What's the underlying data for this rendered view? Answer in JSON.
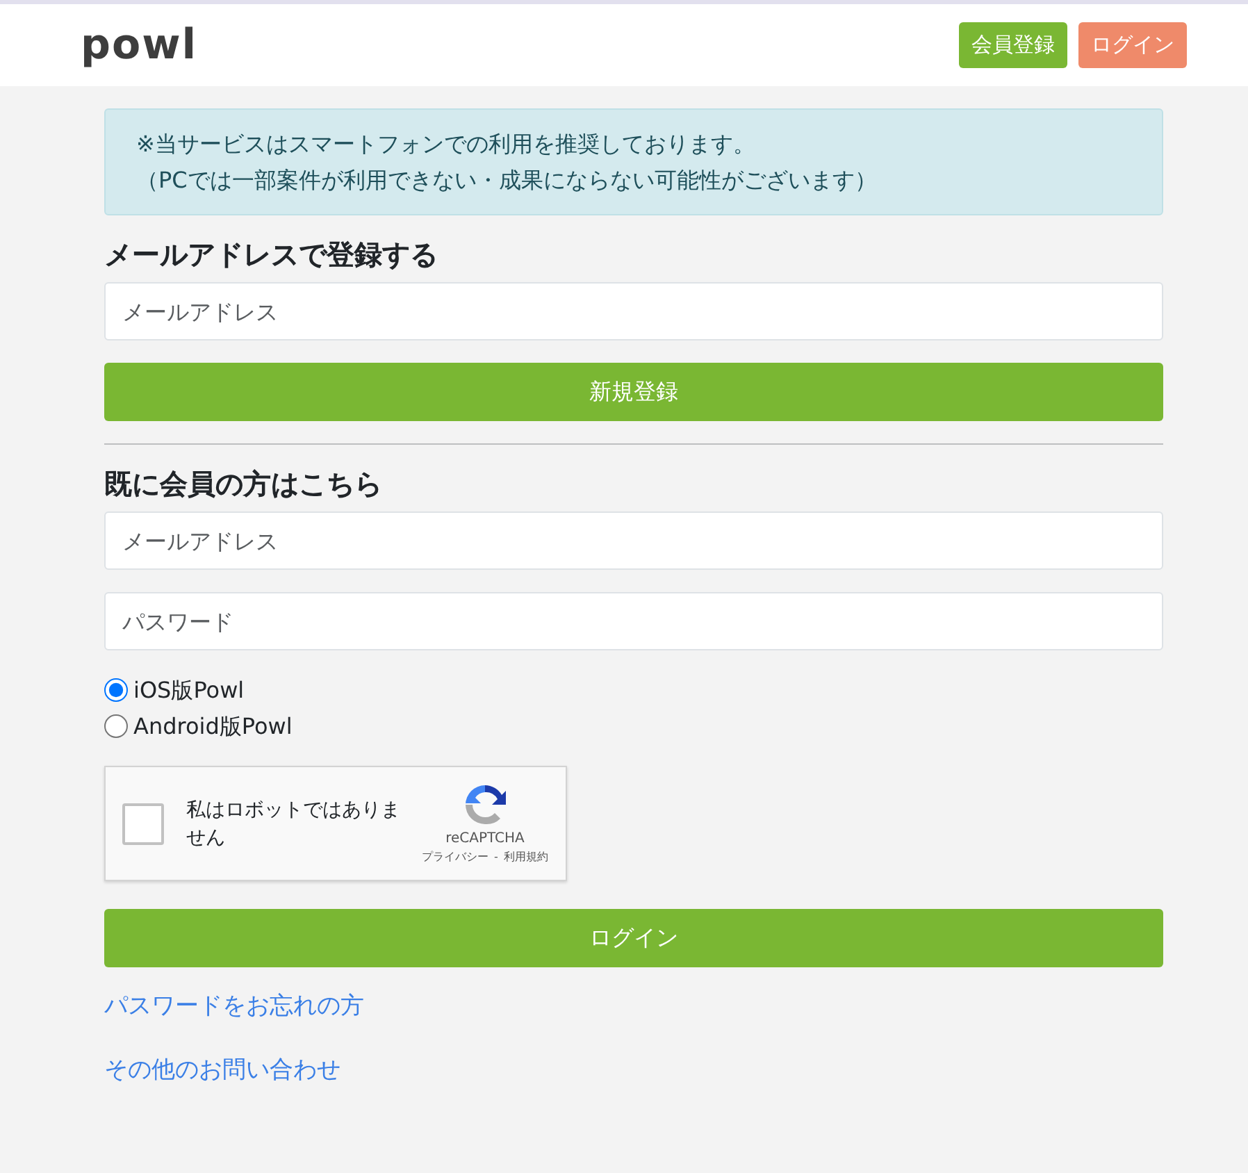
{
  "header": {
    "logo": "powl",
    "buttons": [
      {
        "label": "会員登録",
        "kind": "register"
      },
      {
        "label": "ログイン",
        "kind": "login"
      }
    ]
  },
  "notice": {
    "lines": [
      "※当サービスはスマートフォンでの利用を推奨しております。",
      "（PCでは一部案件が利用できない・成果にならない可能性がございます）"
    ]
  },
  "register": {
    "heading": "メールアドレスで登録する",
    "email": {
      "placeholder": "メールアドレス"
    },
    "button": "新規登録"
  },
  "login": {
    "heading": "既に会員の方はこちら",
    "email": {
      "placeholder": "メールアドレス"
    },
    "password": {
      "placeholder": "パスワード"
    },
    "platforms": [
      {
        "label": "iOS版Powl",
        "selected": true
      },
      {
        "label": "Android版Powl",
        "selected": false
      }
    ],
    "captcha": {
      "label": "私はロボットではありません",
      "checked": false,
      "brand": "reCAPTCHA",
      "privacy": "プライバシー",
      "separator": "-",
      "terms": "利用規約"
    },
    "button": "ログイン"
  },
  "links": [
    "パスワードをお忘れの方",
    "その他のお問い合わせ"
  ]
}
